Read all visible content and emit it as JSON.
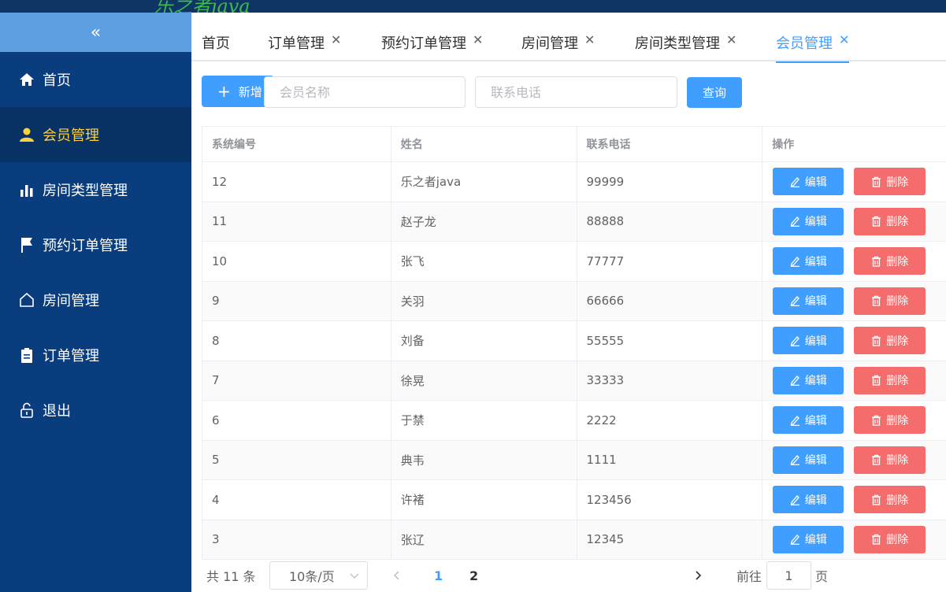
{
  "header": {
    "logo_text": "乐之者java"
  },
  "sidebar": {
    "collapse_glyph": "«",
    "items": [
      {
        "label": "首页",
        "icon": "home-icon"
      },
      {
        "label": "会员管理",
        "icon": "user-icon",
        "active": true
      },
      {
        "label": "房间类型管理",
        "icon": "bar-chart-icon"
      },
      {
        "label": "预约订单管理",
        "icon": "flag-icon"
      },
      {
        "label": "房间管理",
        "icon": "house-outline-icon"
      },
      {
        "label": "订单管理",
        "icon": "clipboard-icon"
      },
      {
        "label": "退出",
        "icon": "unlock-icon"
      }
    ]
  },
  "tabs": [
    {
      "label": "首页",
      "closable": false
    },
    {
      "label": "订单管理",
      "closable": true
    },
    {
      "label": "预约订单管理",
      "closable": true
    },
    {
      "label": "房间管理",
      "closable": true
    },
    {
      "label": "房间类型管理",
      "closable": true
    },
    {
      "label": "会员管理",
      "closable": true,
      "active": true
    }
  ],
  "toolbar": {
    "add_label": "新增",
    "name_placeholder": "会员名称",
    "phone_placeholder": "联系电话",
    "query_label": "查询"
  },
  "table": {
    "columns": [
      "系统编号",
      "姓名",
      "联系电话",
      "操作"
    ],
    "edit_label": "编辑",
    "delete_label": "删除",
    "rows": [
      {
        "id": "12",
        "name": "乐之者java",
        "phone": "99999"
      },
      {
        "id": "11",
        "name": "赵子龙",
        "phone": "88888"
      },
      {
        "id": "10",
        "name": "张飞",
        "phone": "77777"
      },
      {
        "id": "9",
        "name": "关羽",
        "phone": "66666"
      },
      {
        "id": "8",
        "name": "刘备",
        "phone": "55555"
      },
      {
        "id": "7",
        "name": "徐晃",
        "phone": "33333"
      },
      {
        "id": "6",
        "name": "于禁",
        "phone": "2222"
      },
      {
        "id": "5",
        "name": "典韦",
        "phone": "1111"
      },
      {
        "id": "4",
        "name": "许褚",
        "phone": "123456"
      },
      {
        "id": "3",
        "name": "张辽",
        "phone": "12345"
      }
    ]
  },
  "pagination": {
    "total_text": "共 11 条",
    "page_size": "10条/页",
    "pages": [
      "1",
      "2"
    ],
    "current_page": "1",
    "goto_prefix": "前往",
    "goto_value": "1",
    "goto_suffix": "页"
  },
  "colors": {
    "primary": "#409eff",
    "danger": "#f56c6c",
    "sidebar": "#0a3d7e",
    "active_menu_text": "#ffcf3e"
  }
}
